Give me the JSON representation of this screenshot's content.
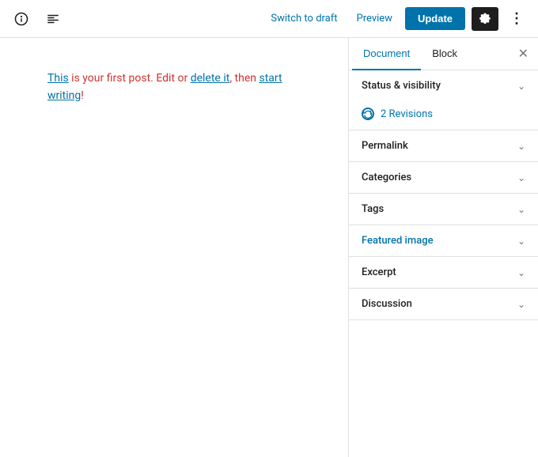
{
  "toolbar": {
    "info_icon": "ℹ",
    "list_icon": "≡",
    "switch_to_draft_label": "Switch to draft",
    "preview_label": "Preview",
    "update_label": "Update",
    "settings_icon": "⚙",
    "more_icon": "⋮"
  },
  "sidebar": {
    "tab_document": "Document",
    "tab_block": "Block",
    "close_icon": "✕",
    "sections": [
      {
        "id": "status-visibility",
        "label": "Status & visibility",
        "featured": false
      },
      {
        "id": "permalink",
        "label": "Permalink",
        "featured": false
      },
      {
        "id": "categories",
        "label": "Categories",
        "featured": false
      },
      {
        "id": "tags",
        "label": "Tags",
        "featured": false
      },
      {
        "id": "featured-image",
        "label": "Featured image",
        "featured": true
      },
      {
        "id": "excerpt",
        "label": "Excerpt",
        "featured": false
      },
      {
        "id": "discussion",
        "label": "Discussion",
        "featured": false
      }
    ],
    "revisions": {
      "icon": "↺",
      "label": "2 Revisions"
    }
  },
  "editor": {
    "content_parts": [
      {
        "text": "This",
        "type": "link"
      },
      {
        "text": " is your first post. Edit or ",
        "type": "plain"
      },
      {
        "text": "delete it",
        "type": "link"
      },
      {
        "text": ", then ",
        "type": "plain"
      },
      {
        "text": "start writing",
        "type": "link"
      },
      {
        "text": "!",
        "type": "plain"
      }
    ]
  }
}
